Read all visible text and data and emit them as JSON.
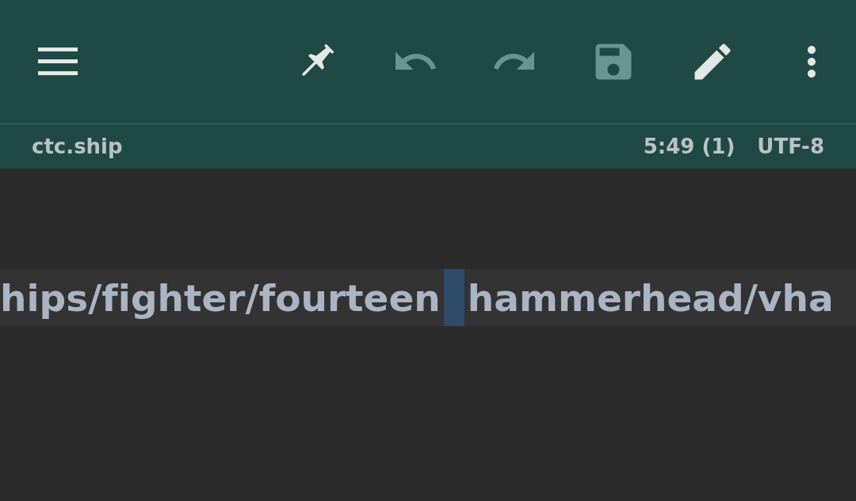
{
  "toolbar": {
    "actions": [
      {
        "kind": "pin",
        "disabled": false
      },
      {
        "kind": "undo",
        "disabled": true
      },
      {
        "kind": "redo",
        "disabled": true
      },
      {
        "kind": "save",
        "disabled": true
      },
      {
        "kind": "edit",
        "disabled": false
      },
      {
        "kind": "more",
        "disabled": false
      }
    ]
  },
  "status_bar": {
    "file_name": "ctc.ship",
    "position": "5:49 (1)",
    "encoding": "UTF-8"
  },
  "editor": {
    "current_line": {
      "before": "hips/fighter/fourteen",
      "after": "hammerhead/vha"
    }
  }
}
